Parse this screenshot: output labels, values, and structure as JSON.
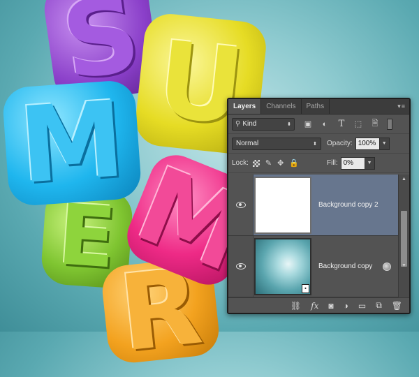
{
  "artwork": {
    "letters": [
      "S",
      "U",
      "M",
      "M",
      "E",
      "R"
    ]
  },
  "panel": {
    "tabs": [
      {
        "label": "Layers",
        "active": true
      },
      {
        "label": "Channels",
        "active": false
      },
      {
        "label": "Paths",
        "active": false
      }
    ],
    "filter": {
      "label": "Kind"
    },
    "blend_mode": "Normal",
    "opacity_label": "Opacity:",
    "opacity_value": "100%",
    "lock_label": "Lock:",
    "fill_label": "Fill:",
    "fill_value": "0%",
    "layers": [
      {
        "name": "Background copy 2",
        "selected": true,
        "visible": true
      },
      {
        "name": "Background copy",
        "selected": false,
        "visible": true
      }
    ],
    "footer_icons": [
      "link-icon",
      "fx-icon",
      "mask-icon",
      "adjustment-icon",
      "folder-icon",
      "new-layer-icon",
      "trash-icon"
    ]
  }
}
